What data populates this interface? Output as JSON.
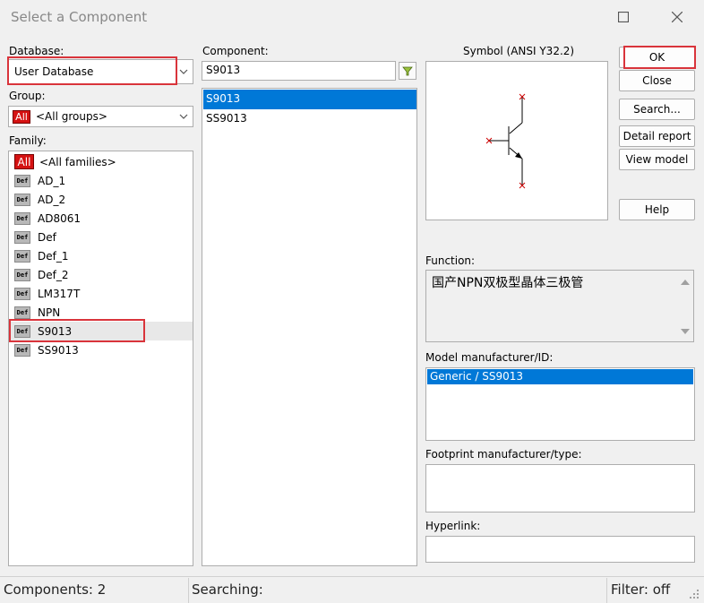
{
  "window": {
    "title": "Select a Component",
    "maximize_icon": "square-icon",
    "close_icon": "x-icon"
  },
  "database": {
    "label": "Database:",
    "value": "User Database"
  },
  "group": {
    "label": "Group:",
    "icon": "All",
    "value": "<All groups>"
  },
  "family": {
    "label": "Family:",
    "items": [
      {
        "icon": "All",
        "label": "<All families>"
      },
      {
        "icon": "Def",
        "label": "AD_1"
      },
      {
        "icon": "Def",
        "label": "AD_2"
      },
      {
        "icon": "Def",
        "label": "AD8061"
      },
      {
        "icon": "Def",
        "label": "Def"
      },
      {
        "icon": "Def",
        "label": "Def_1"
      },
      {
        "icon": "Def",
        "label": "Def_2"
      },
      {
        "icon": "Def",
        "label": "LM317T"
      },
      {
        "icon": "Def",
        "label": "NPN"
      },
      {
        "icon": "Def",
        "label": "S9013"
      },
      {
        "icon": "Def",
        "label": "SS9013"
      }
    ],
    "selected": "S9013"
  },
  "component": {
    "label": "Component:",
    "search_value": "S9013",
    "items": [
      "S9013",
      "SS9013"
    ],
    "selected": "S9013"
  },
  "symbol": {
    "label": "Symbol (ANSI Y32.2)"
  },
  "buttons": {
    "ok": "OK",
    "close": "Close",
    "search": "Search...",
    "detail_report": "Detail report",
    "view_model": "View model",
    "help": "Help"
  },
  "function": {
    "label": "Function:",
    "value": "国产NPN双极型晶体三极管"
  },
  "model": {
    "label": "Model manufacturer/ID:",
    "items": [
      "Generic / SS9013"
    ]
  },
  "footprint": {
    "label": "Footprint manufacturer/type:"
  },
  "hyperlink": {
    "label": "Hyperlink:"
  },
  "status": {
    "components": "Components: 2",
    "searching": "Searching:",
    "filter": "Filter: off"
  },
  "colors": {
    "selection": "#0078d7",
    "highlight_border": "#d9343b",
    "all_icon": "#d51212"
  }
}
